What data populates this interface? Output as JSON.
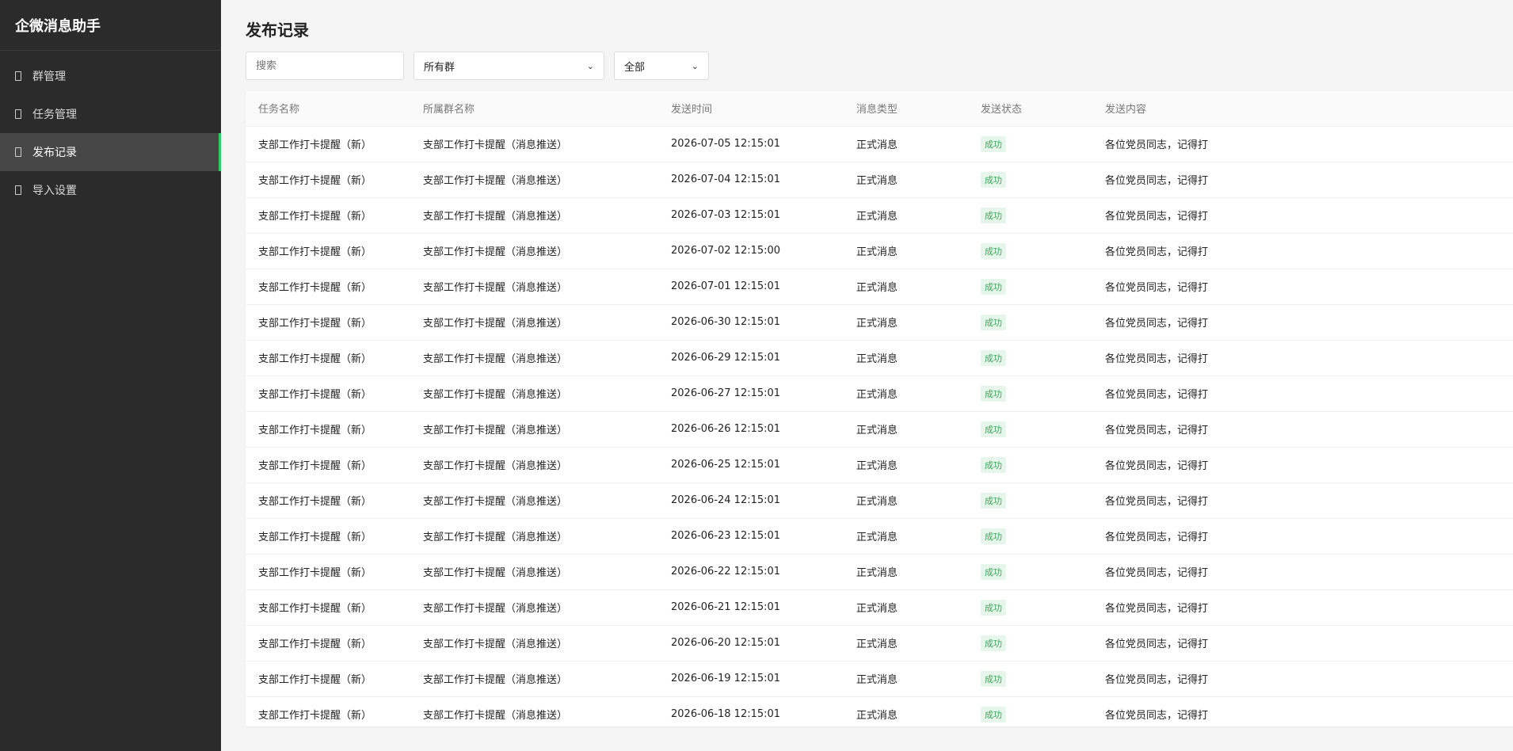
{
  "app": {
    "title": "企微消息助手"
  },
  "sidebar": {
    "items": [
      {
        "label": "群管理",
        "icon": "group-icon"
      },
      {
        "label": "任务管理",
        "icon": "task-icon"
      },
      {
        "label": "发布记录",
        "icon": "record-icon",
        "active": true
      },
      {
        "label": "导入设置",
        "icon": "import-icon"
      }
    ]
  },
  "page": {
    "title": "发布记录"
  },
  "filters": {
    "search_placeholder": "搜索",
    "group_select_value": "所有群",
    "status_select_value": "全部"
  },
  "table": {
    "headers": [
      "任务名称",
      "所属群名称",
      "发送时间",
      "消息类型",
      "发送状态",
      "发送内容"
    ],
    "rows": [
      {
        "task": "支部工作打卡提醒（新）",
        "group": "支部工作打卡提醒（消息推送）",
        "time": "2026-07-05 12:15:01",
        "type": "正式消息",
        "status": "成功",
        "content": "各位党员同志，记得打"
      },
      {
        "task": "支部工作打卡提醒（新）",
        "group": "支部工作打卡提醒（消息推送）",
        "time": "2026-07-04 12:15:01",
        "type": "正式消息",
        "status": "成功",
        "content": "各位党员同志，记得打"
      },
      {
        "task": "支部工作打卡提醒（新）",
        "group": "支部工作打卡提醒（消息推送）",
        "time": "2026-07-03 12:15:01",
        "type": "正式消息",
        "status": "成功",
        "content": "各位党员同志，记得打"
      },
      {
        "task": "支部工作打卡提醒（新）",
        "group": "支部工作打卡提醒（消息推送）",
        "time": "2026-07-02 12:15:00",
        "type": "正式消息",
        "status": "成功",
        "content": "各位党员同志，记得打"
      },
      {
        "task": "支部工作打卡提醒（新）",
        "group": "支部工作打卡提醒（消息推送）",
        "time": "2026-07-01 12:15:01",
        "type": "正式消息",
        "status": "成功",
        "content": "各位党员同志，记得打"
      },
      {
        "task": "支部工作打卡提醒（新）",
        "group": "支部工作打卡提醒（消息推送）",
        "time": "2026-06-30 12:15:01",
        "type": "正式消息",
        "status": "成功",
        "content": "各位党员同志，记得打"
      },
      {
        "task": "支部工作打卡提醒（新）",
        "group": "支部工作打卡提醒（消息推送）",
        "time": "2026-06-29 12:15:01",
        "type": "正式消息",
        "status": "成功",
        "content": "各位党员同志，记得打"
      },
      {
        "task": "支部工作打卡提醒（新）",
        "group": "支部工作打卡提醒（消息推送）",
        "time": "2026-06-27 12:15:01",
        "type": "正式消息",
        "status": "成功",
        "content": "各位党员同志，记得打"
      },
      {
        "task": "支部工作打卡提醒（新）",
        "group": "支部工作打卡提醒（消息推送）",
        "time": "2026-06-26 12:15:01",
        "type": "正式消息",
        "status": "成功",
        "content": "各位党员同志，记得打"
      },
      {
        "task": "支部工作打卡提醒（新）",
        "group": "支部工作打卡提醒（消息推送）",
        "time": "2026-06-25 12:15:01",
        "type": "正式消息",
        "status": "成功",
        "content": "各位党员同志，记得打"
      },
      {
        "task": "支部工作打卡提醒（新）",
        "group": "支部工作打卡提醒（消息推送）",
        "time": "2026-06-24 12:15:01",
        "type": "正式消息",
        "status": "成功",
        "content": "各位党员同志，记得打"
      },
      {
        "task": "支部工作打卡提醒（新）",
        "group": "支部工作打卡提醒（消息推送）",
        "time": "2026-06-23 12:15:01",
        "type": "正式消息",
        "status": "成功",
        "content": "各位党员同志，记得打"
      },
      {
        "task": "支部工作打卡提醒（新）",
        "group": "支部工作打卡提醒（消息推送）",
        "time": "2026-06-22 12:15:01",
        "type": "正式消息",
        "status": "成功",
        "content": "各位党员同志，记得打"
      },
      {
        "task": "支部工作打卡提醒（新）",
        "group": "支部工作打卡提醒（消息推送）",
        "time": "2026-06-21 12:15:01",
        "type": "正式消息",
        "status": "成功",
        "content": "各位党员同志，记得打"
      },
      {
        "task": "支部工作打卡提醒（新）",
        "group": "支部工作打卡提醒（消息推送）",
        "time": "2026-06-20 12:15:01",
        "type": "正式消息",
        "status": "成功",
        "content": "各位党员同志，记得打"
      },
      {
        "task": "支部工作打卡提醒（新）",
        "group": "支部工作打卡提醒（消息推送）",
        "time": "2026-06-19 12:15:01",
        "type": "正式消息",
        "status": "成功",
        "content": "各位党员同志，记得打"
      },
      {
        "task": "支部工作打卡提醒（新）",
        "group": "支部工作打卡提醒（消息推送）",
        "time": "2026-06-18 12:15:01",
        "type": "正式消息",
        "status": "成功",
        "content": "各位党员同志，记得打"
      }
    ]
  },
  "colors": {
    "sidebar_bg": "#2b2b2b",
    "sidebar_active_bg": "#474747",
    "accent": "#2ecc71",
    "success_badge_bg": "#e7f6ea",
    "success_badge_text": "#3ba55c"
  }
}
